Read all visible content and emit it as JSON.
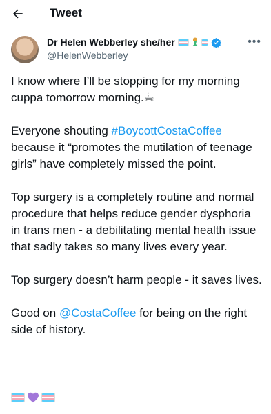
{
  "header": {
    "title": "Tweet"
  },
  "author": {
    "name": "Dr Helen Webberley she/her",
    "handle": "@HelenWebberley"
  },
  "tweet": {
    "p1": "I know where I’ll be stopping for my morning cuppa tomorrow morning.☕",
    "p2_pre": "Everyone shouting ",
    "p2_hashtag": "#BoycottCostaCoffee",
    "p2_post": " because it “promotes the mutilation of teenage girls” have completely missed the point.",
    "p3": "Top surgery is a completely routine and normal procedure that helps reduce gender dysphoria in trans men - a debilitating mental health issue that sadly takes so many lives every year.",
    "p4": "Top surgery doesn’t harm people - it saves lives.",
    "p5_pre": "Good on ",
    "p5_mention": "@CostaCoffee",
    "p5_post": " for being on the right side of history."
  },
  "icons": {
    "back": "back-arrow-icon",
    "more": "more-icon",
    "verified": "verified-badge-icon",
    "trans_flag": "transgender-flag-icon",
    "mermaid": "mermaid-icon",
    "heart": "purple-heart-icon"
  },
  "colors": {
    "link": "#1d9bf0",
    "verified": "#1d9bf0",
    "heart": "#a277d9"
  }
}
